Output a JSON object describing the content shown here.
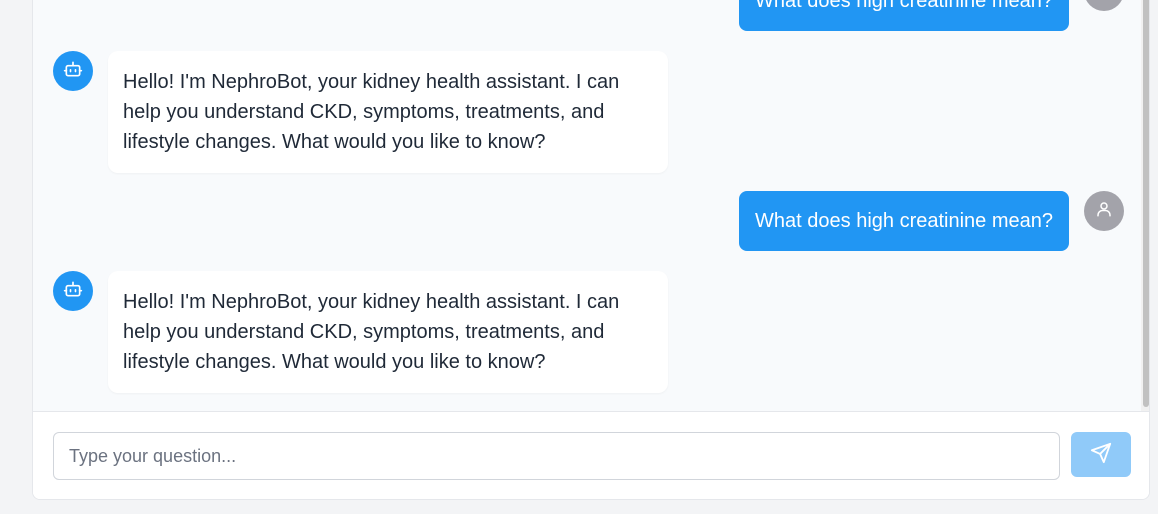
{
  "messages": [
    {
      "role": "user",
      "text": "What does high creatinine mean?",
      "avatar_icon": "user-icon"
    },
    {
      "role": "bot",
      "text": "Hello! I'm NephroBot, your kidney health assistant. I can help you understand CKD, symptoms, treatments, and lifestyle changes. What would you like to know?",
      "avatar_icon": "robot-icon"
    },
    {
      "role": "user",
      "text": "What does high creatinine mean?",
      "avatar_icon": "user-icon"
    },
    {
      "role": "bot",
      "text": "Hello! I'm NephroBot, your kidney health assistant. I can help you understand CKD, symptoms, treatments, and lifestyle changes. What would you like to know?",
      "avatar_icon": "robot-icon"
    }
  ],
  "composer": {
    "placeholder": "Type your question...",
    "value": "",
    "send_icon": "send-icon"
  },
  "colors": {
    "accent": "#2196f3",
    "send_disabled": "#90caf9",
    "user_avatar": "#a3a3aa",
    "chat_background": "#f8fafc"
  }
}
